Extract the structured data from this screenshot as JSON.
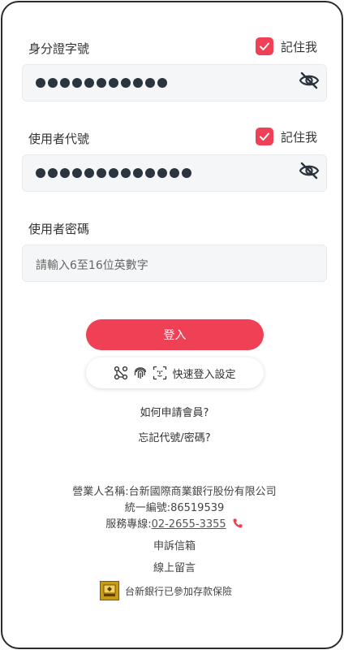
{
  "login": {
    "id_label": "身分證字號",
    "remember_label": "記住我",
    "id_masked_count": 11,
    "user_label": "使用者代號",
    "user_masked_count": 13,
    "password_label": "使用者密碼",
    "password_placeholder": "請輸入6至16位英數字",
    "login_button": "登入",
    "quick_login_label": "快速登入設定"
  },
  "links": {
    "how_to_join": "如何申請會員?",
    "forgot": "忘記代號/密碼?"
  },
  "footer": {
    "company": "營業人名稱:台新國際商業銀行股份有限公司",
    "tax_id": "統一編號:86519539",
    "service_label": "服務專線:",
    "service_phone": "02-2655-3355",
    "complaint": "申訴信箱",
    "message": "線上留言",
    "insurance": "台新銀行已參加存款保險"
  },
  "colors": {
    "accent": "#ef4055",
    "dot": "#2c3440"
  },
  "icons": [
    "check-icon",
    "eye-off-icon",
    "biometric-icon",
    "fingerprint-icon",
    "face-id-icon",
    "phone-icon",
    "deposit-insurance-badge-icon"
  ]
}
